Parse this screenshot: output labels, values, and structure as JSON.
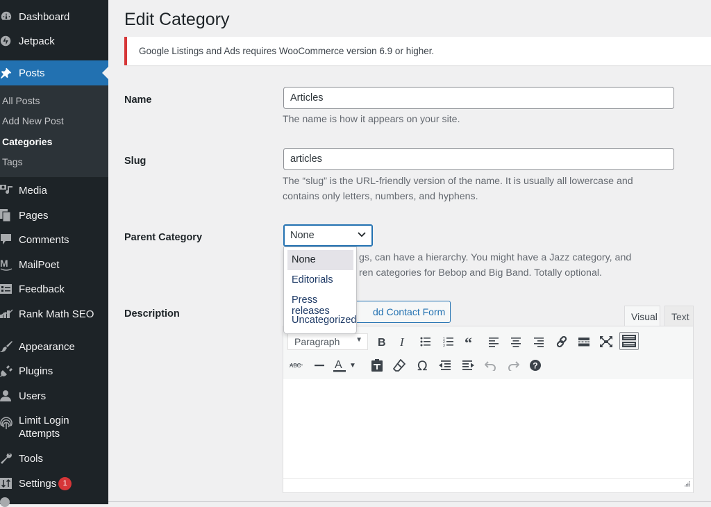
{
  "sidebar": {
    "items": [
      {
        "id": "dashboard",
        "label": "Dashboard",
        "icon": "dashboard-icon"
      },
      {
        "id": "jetpack",
        "label": "Jetpack",
        "icon": "jetpack-icon"
      },
      {
        "id": "posts",
        "label": "Posts",
        "icon": "pushpin-icon",
        "active": true
      },
      {
        "id": "media",
        "label": "Media",
        "icon": "media-icon"
      },
      {
        "id": "pages",
        "label": "Pages",
        "icon": "pages-icon"
      },
      {
        "id": "comments",
        "label": "Comments",
        "icon": "comment-icon"
      },
      {
        "id": "mailpoet",
        "label": "MailPoet",
        "icon": "mailpoet-icon"
      },
      {
        "id": "feedback",
        "label": "Feedback",
        "icon": "feedback-icon"
      },
      {
        "id": "rankmath",
        "label": "Rank Math SEO",
        "icon": "rankmath-icon"
      },
      {
        "id": "appearance",
        "label": "Appearance",
        "icon": "paintbrush-icon"
      },
      {
        "id": "plugins",
        "label": "Plugins",
        "icon": "plug-icon"
      },
      {
        "id": "users",
        "label": "Users",
        "icon": "user-icon"
      },
      {
        "id": "limitlogin",
        "label": "Limit Login",
        "label2": "Attempts",
        "icon": "fingerprint-icon"
      },
      {
        "id": "tools",
        "label": "Tools",
        "icon": "wrench-icon"
      },
      {
        "id": "settings",
        "label": "Settings",
        "icon": "settings-icon",
        "badge": "1"
      }
    ],
    "submenu": [
      {
        "label": "All Posts"
      },
      {
        "label": "Add New Post"
      },
      {
        "label": "Categories",
        "current": true
      },
      {
        "label": "Tags"
      }
    ]
  },
  "page": {
    "title": "Edit Category",
    "notice": "Google Listings and Ads requires WooCommerce version 6.9 or higher.",
    "colors": {
      "accent": "#2271b1",
      "error": "#d63638",
      "sidebar_bg": "#1d2327"
    }
  },
  "form": {
    "name": {
      "label": "Name",
      "value": "Articles",
      "description": "The name is how it appears on your site."
    },
    "slug": {
      "label": "Slug",
      "value": "articles",
      "description_line1": "The “slug” is the URL-friendly version of the name. It is usually all lowercase and",
      "description_line2": "contains only letters, numbers, and hyphens."
    },
    "parent": {
      "label": "Parent Category",
      "selected": "None",
      "options": [
        "None",
        "Editorials",
        "Press releases",
        "Uncategorized"
      ],
      "description_line1": "Categories, unlike tags, can have a hierarchy. You might have a Jazz category, and",
      "description_line2": "under that have children categories for Bebop and Big Band. Totally optional.",
      "visible_line1": "gs, can have a hierarchy. You might have a Jazz category, and",
      "visible_line2": "ren categories for Bebop and Big Band. Totally optional."
    },
    "description": {
      "label": "Description",
      "add_contact_form": "Add Contact Form",
      "visible_button_text": "dd Contact Form",
      "tabs": {
        "visual": "Visual",
        "text": "Text",
        "active": "visual"
      },
      "format_select": "Paragraph",
      "toolbar_row1": [
        "bold",
        "italic",
        "bulleted-list",
        "numbered-list",
        "blockquote",
        "align-left",
        "align-center",
        "align-right",
        "insert-link",
        "read-more",
        "fullscreen",
        "toolbar-toggle"
      ],
      "toolbar_row2": [
        "strikethrough",
        "horizontal-line",
        "text-color",
        "paste-as-text",
        "clear-formatting",
        "special-character",
        "outdent",
        "indent",
        "undo",
        "redo",
        "keyboard-shortcuts"
      ]
    }
  }
}
